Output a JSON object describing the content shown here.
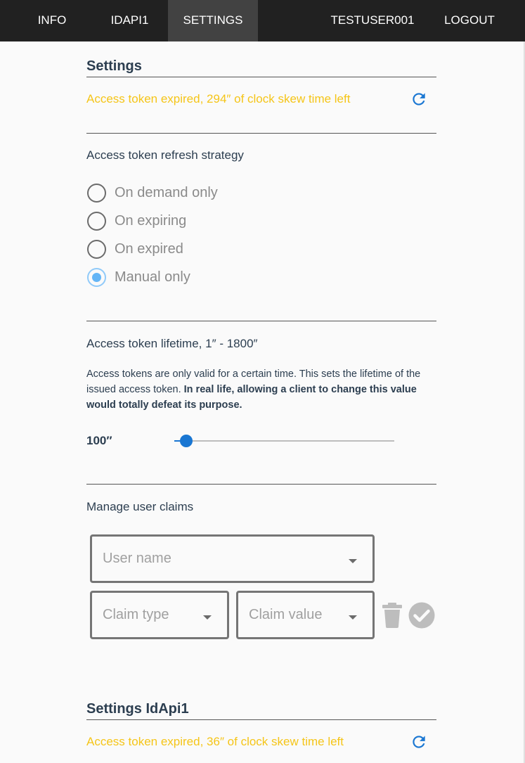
{
  "nav": {
    "left_items": [
      {
        "label": "INFO",
        "active": false
      },
      {
        "label": "IDAPI1",
        "active": false
      },
      {
        "label": "SETTINGS",
        "active": true
      }
    ],
    "user": "TESTUSER001",
    "logout": "LOGOUT"
  },
  "settings": {
    "title": "Settings",
    "token_status": "Access token expired, 294″ of clock skew time left",
    "refresh_icon": "refresh-icon"
  },
  "refresh_strategy": {
    "label": "Access token refresh strategy",
    "options": [
      {
        "label": "On demand only",
        "selected": false
      },
      {
        "label": "On expiring",
        "selected": false
      },
      {
        "label": "On expired",
        "selected": false
      },
      {
        "label": "Manual only",
        "selected": true
      }
    ]
  },
  "lifetime": {
    "label": "Access token lifetime, 1″ - 1800″",
    "desc_plain": "Access tokens are only valid for a certain time. This sets the lifetime of the issued access token. ",
    "desc_bold": "In real life, allowing a client to change this value would totally defeat its purpose.",
    "value_label": "100″",
    "min": 1,
    "max": 1800,
    "value": 100
  },
  "claims": {
    "label": "Manage user claims",
    "user_name_placeholder": "User name",
    "claim_type_placeholder": "Claim type",
    "claim_value_placeholder": "Claim value",
    "delete_icon": "trash-icon",
    "confirm_icon": "check-circle-icon"
  },
  "idapi1": {
    "title": "Settings IdApi1",
    "token_status": "Access token expired, 36″ of clock skew time left"
  },
  "colors": {
    "nav_bg": "#212121",
    "nav_active": "#424242",
    "warning": "#f5c518",
    "accent": "#1976d2",
    "radio_selected": "#64b5f6",
    "disabled_icon": "#bdbdbd"
  }
}
